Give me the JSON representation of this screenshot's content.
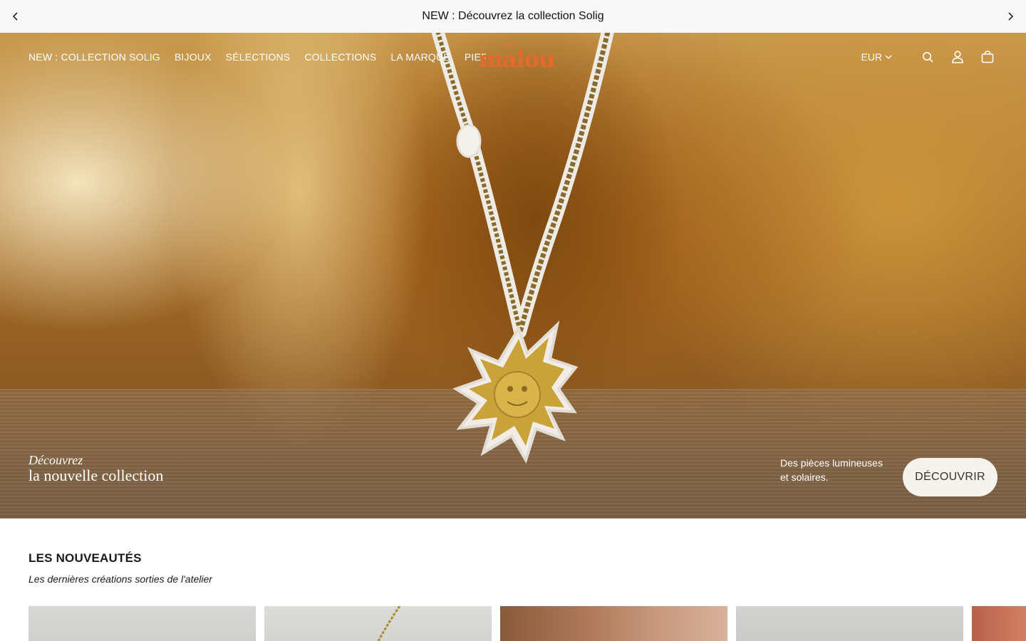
{
  "announcement": {
    "text": "NEW : Découvrez la collection Solig"
  },
  "nav": {
    "items": [
      {
        "label": "NEW : COLLECTION SOLIG"
      },
      {
        "label": "BIJOUX"
      },
      {
        "label": "SÉLECTIONS"
      },
      {
        "label": "COLLECTIONS"
      },
      {
        "label": "LA MARQUE"
      },
      {
        "label": "PIERRES"
      }
    ]
  },
  "logo": {
    "small": "LES",
    "big": "malou"
  },
  "header": {
    "currency": "EUR",
    "icons": [
      "search-icon",
      "account-icon",
      "bag-icon"
    ]
  },
  "hero": {
    "caption_line1": "Découvrez",
    "caption_line2": "la nouvelle collection",
    "side_line1": "Des pièces lumineuses",
    "side_line2": "et solaires.",
    "cta": "DÉCOUVRIR"
  },
  "new_arrivals": {
    "title": "LES NOUVEAUTÉS",
    "subtitle": "Les dernières créations sorties de l'atelier"
  },
  "colors": {
    "logo": "#e26a2c",
    "cta_bg": "#f6f2ee",
    "announce_bg": "#f8f8f8"
  }
}
